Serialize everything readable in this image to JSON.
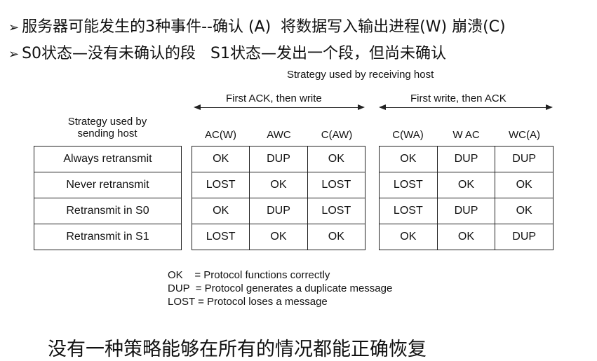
{
  "bullets": [
    "服务器可能发生的3种事件--确认 (A)  将数据写入输出进程(W) 崩溃(C)",
    "S0状态—没有未确认的段   S1状态—发出一个段，但尚未确认"
  ],
  "bullet_marker": "➢",
  "diagram": {
    "receiving_title": "Strategy used by receiving host",
    "group1_label": "First ACK, then write",
    "group2_label": "First  write, then ACK",
    "sending_header_line1": "Strategy used by",
    "sending_header_line2": "sending host",
    "group1_columns": [
      "AC(W)",
      "AWC",
      "C(AW)"
    ],
    "group2_columns": [
      "C(WA)",
      "W AC",
      "WC(A)"
    ],
    "rows": [
      {
        "strategy": "Always retransmit",
        "group1": [
          "OK",
          "DUP",
          "OK"
        ],
        "group2": [
          "OK",
          "DUP",
          "DUP"
        ]
      },
      {
        "strategy": "Never retransmit",
        "group1": [
          "LOST",
          "OK",
          "LOST"
        ],
        "group2": [
          "LOST",
          "OK",
          "OK"
        ]
      },
      {
        "strategy": "Retransmit in S0",
        "group1": [
          "OK",
          "DUP",
          "LOST"
        ],
        "group2": [
          "LOST",
          "DUP",
          "OK"
        ]
      },
      {
        "strategy": "Retransmit in S1",
        "group1": [
          "LOST",
          "OK",
          "OK"
        ],
        "group2": [
          "OK",
          "OK",
          "DUP"
        ]
      }
    ],
    "legend": [
      "OK    = Protocol functions correctly",
      "DUP  = Protocol generates a duplicate message",
      "LOST = Protocol loses a message"
    ]
  },
  "conclusion": "没有一种策略能够在所有的情况都能正确恢复"
}
